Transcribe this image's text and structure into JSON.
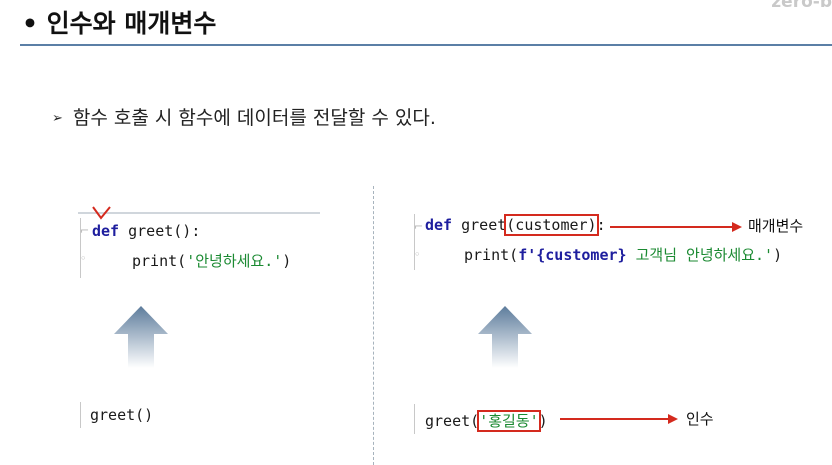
{
  "header": {
    "title": "• 인수와 매개변수",
    "brand": "zero-b"
  },
  "subtitle": "함수 호출 시 함수에 데이터를 전달할 수 있다.",
  "subtitle_arrow": "➢",
  "left": {
    "def_kw": "def",
    "def_rest": " greet():",
    "print_head": "print(",
    "print_str": "'안녕하세요.'",
    "print_tail": ")",
    "call": "greet()"
  },
  "right": {
    "def_kw": "def",
    "def_name": " greet",
    "params": "(customer)",
    "colon": ":",
    "print_head": "print(",
    "fstr_prefix": "f'",
    "fstr_var": "{customer}",
    "fstr_text": " 고객님 안녕하세요.'",
    "print_tail": ")",
    "call_head": "greet(",
    "call_arg": "'홍길동'",
    "call_tail": ")"
  },
  "annotations": {
    "parameter": "매개변수",
    "argument": "인수"
  },
  "colors": {
    "keyword": "#1e1e9e",
    "string": "#1b8a32",
    "highlight": "#d42a1e",
    "rule": "#5b7fa6",
    "arrow": "#5d7c9c"
  },
  "icons": [
    "up-arrow-icon",
    "cursor-caret-icon",
    "fold-marker-icon"
  ]
}
